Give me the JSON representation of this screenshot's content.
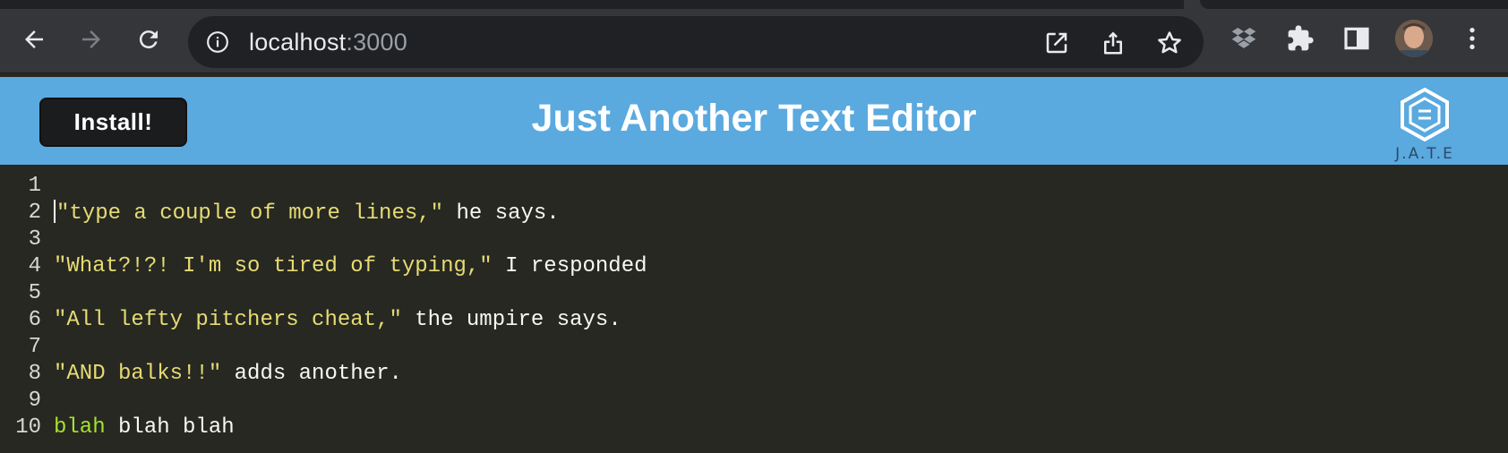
{
  "browser": {
    "url_host": "localhost",
    "url_port": ":3000"
  },
  "app": {
    "install_label": "Install!",
    "title": "Just Another Text Editor",
    "logo_text": "J.A.T.E"
  },
  "editor": {
    "lines": [
      {
        "num": "1",
        "parts": []
      },
      {
        "num": "2",
        "cursor": true,
        "parts": [
          {
            "t": "\"type a couple of more lines,\"",
            "c": "str"
          },
          {
            "t": " he says.",
            "c": ""
          }
        ]
      },
      {
        "num": "3",
        "parts": []
      },
      {
        "num": "4",
        "parts": [
          {
            "t": "\"What?!?! I'm so tired of typing,\"",
            "c": "str"
          },
          {
            "t": " I responded",
            "c": ""
          }
        ]
      },
      {
        "num": "5",
        "parts": []
      },
      {
        "num": "6",
        "parts": [
          {
            "t": "\"All lefty pitchers cheat,\"",
            "c": "str"
          },
          {
            "t": " the umpire says.",
            "c": ""
          }
        ]
      },
      {
        "num": "7",
        "parts": []
      },
      {
        "num": "8",
        "parts": [
          {
            "t": "\"AND balks!!\"",
            "c": "str"
          },
          {
            "t": " adds another.",
            "c": ""
          }
        ]
      },
      {
        "num": "9",
        "parts": []
      },
      {
        "num": "10",
        "parts": [
          {
            "t": "blah",
            "c": "kw"
          },
          {
            "t": " blah blah",
            "c": ""
          }
        ]
      }
    ]
  },
  "colors": {
    "header_bg": "#5aa9df",
    "editor_bg": "#272822",
    "string": "#e6db74",
    "keyword": "#a6e22e"
  }
}
